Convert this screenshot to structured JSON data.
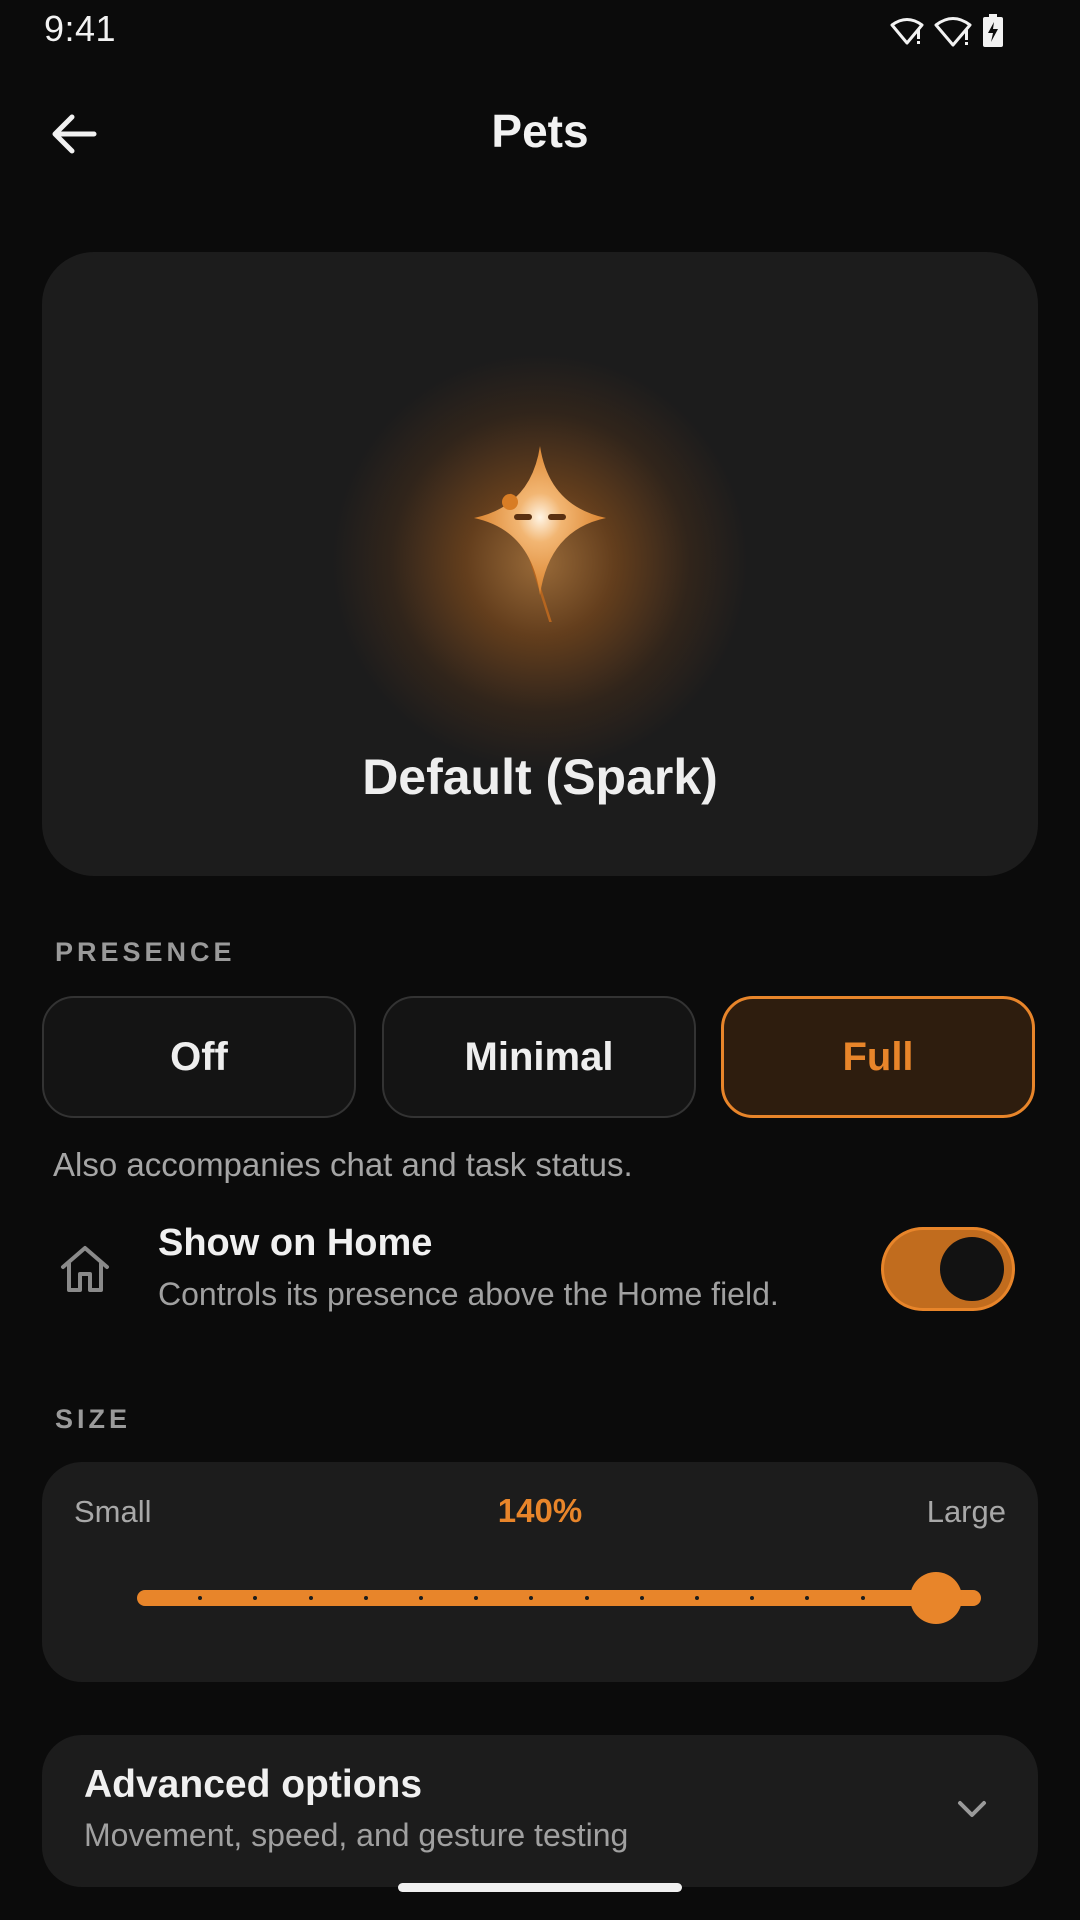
{
  "status_bar": {
    "time": "9:41",
    "icons": [
      "wifi-alert-icon",
      "wifi-alert-icon",
      "battery-charging-icon"
    ]
  },
  "app_bar": {
    "title": "Pets",
    "back_icon": "arrow-left-icon"
  },
  "preview": {
    "pet_name": "Default (Spark)",
    "pet_icon": "spark-star-icon"
  },
  "presence": {
    "label": "PRESENCE",
    "options": [
      "Off",
      "Minimal",
      "Full"
    ],
    "selected": "Full",
    "helper": "Also accompanies chat and task status."
  },
  "show_on_home": {
    "icon": "home-icon",
    "title": "Show on Home",
    "subtitle": "Controls its presence above the Home field.",
    "enabled": true
  },
  "size": {
    "label": "SIZE",
    "min_label": "Small",
    "max_label": "Large",
    "value_text": "140%",
    "slider_fraction": 1.0,
    "steps": 15
  },
  "advanced": {
    "title": "Advanced options",
    "subtitle": "Movement, speed, and gesture testing",
    "icon": "chevron-down-icon"
  },
  "colors": {
    "accent": "#e8852a",
    "background": "#0b0b0b",
    "card": "#1c1c1c"
  }
}
